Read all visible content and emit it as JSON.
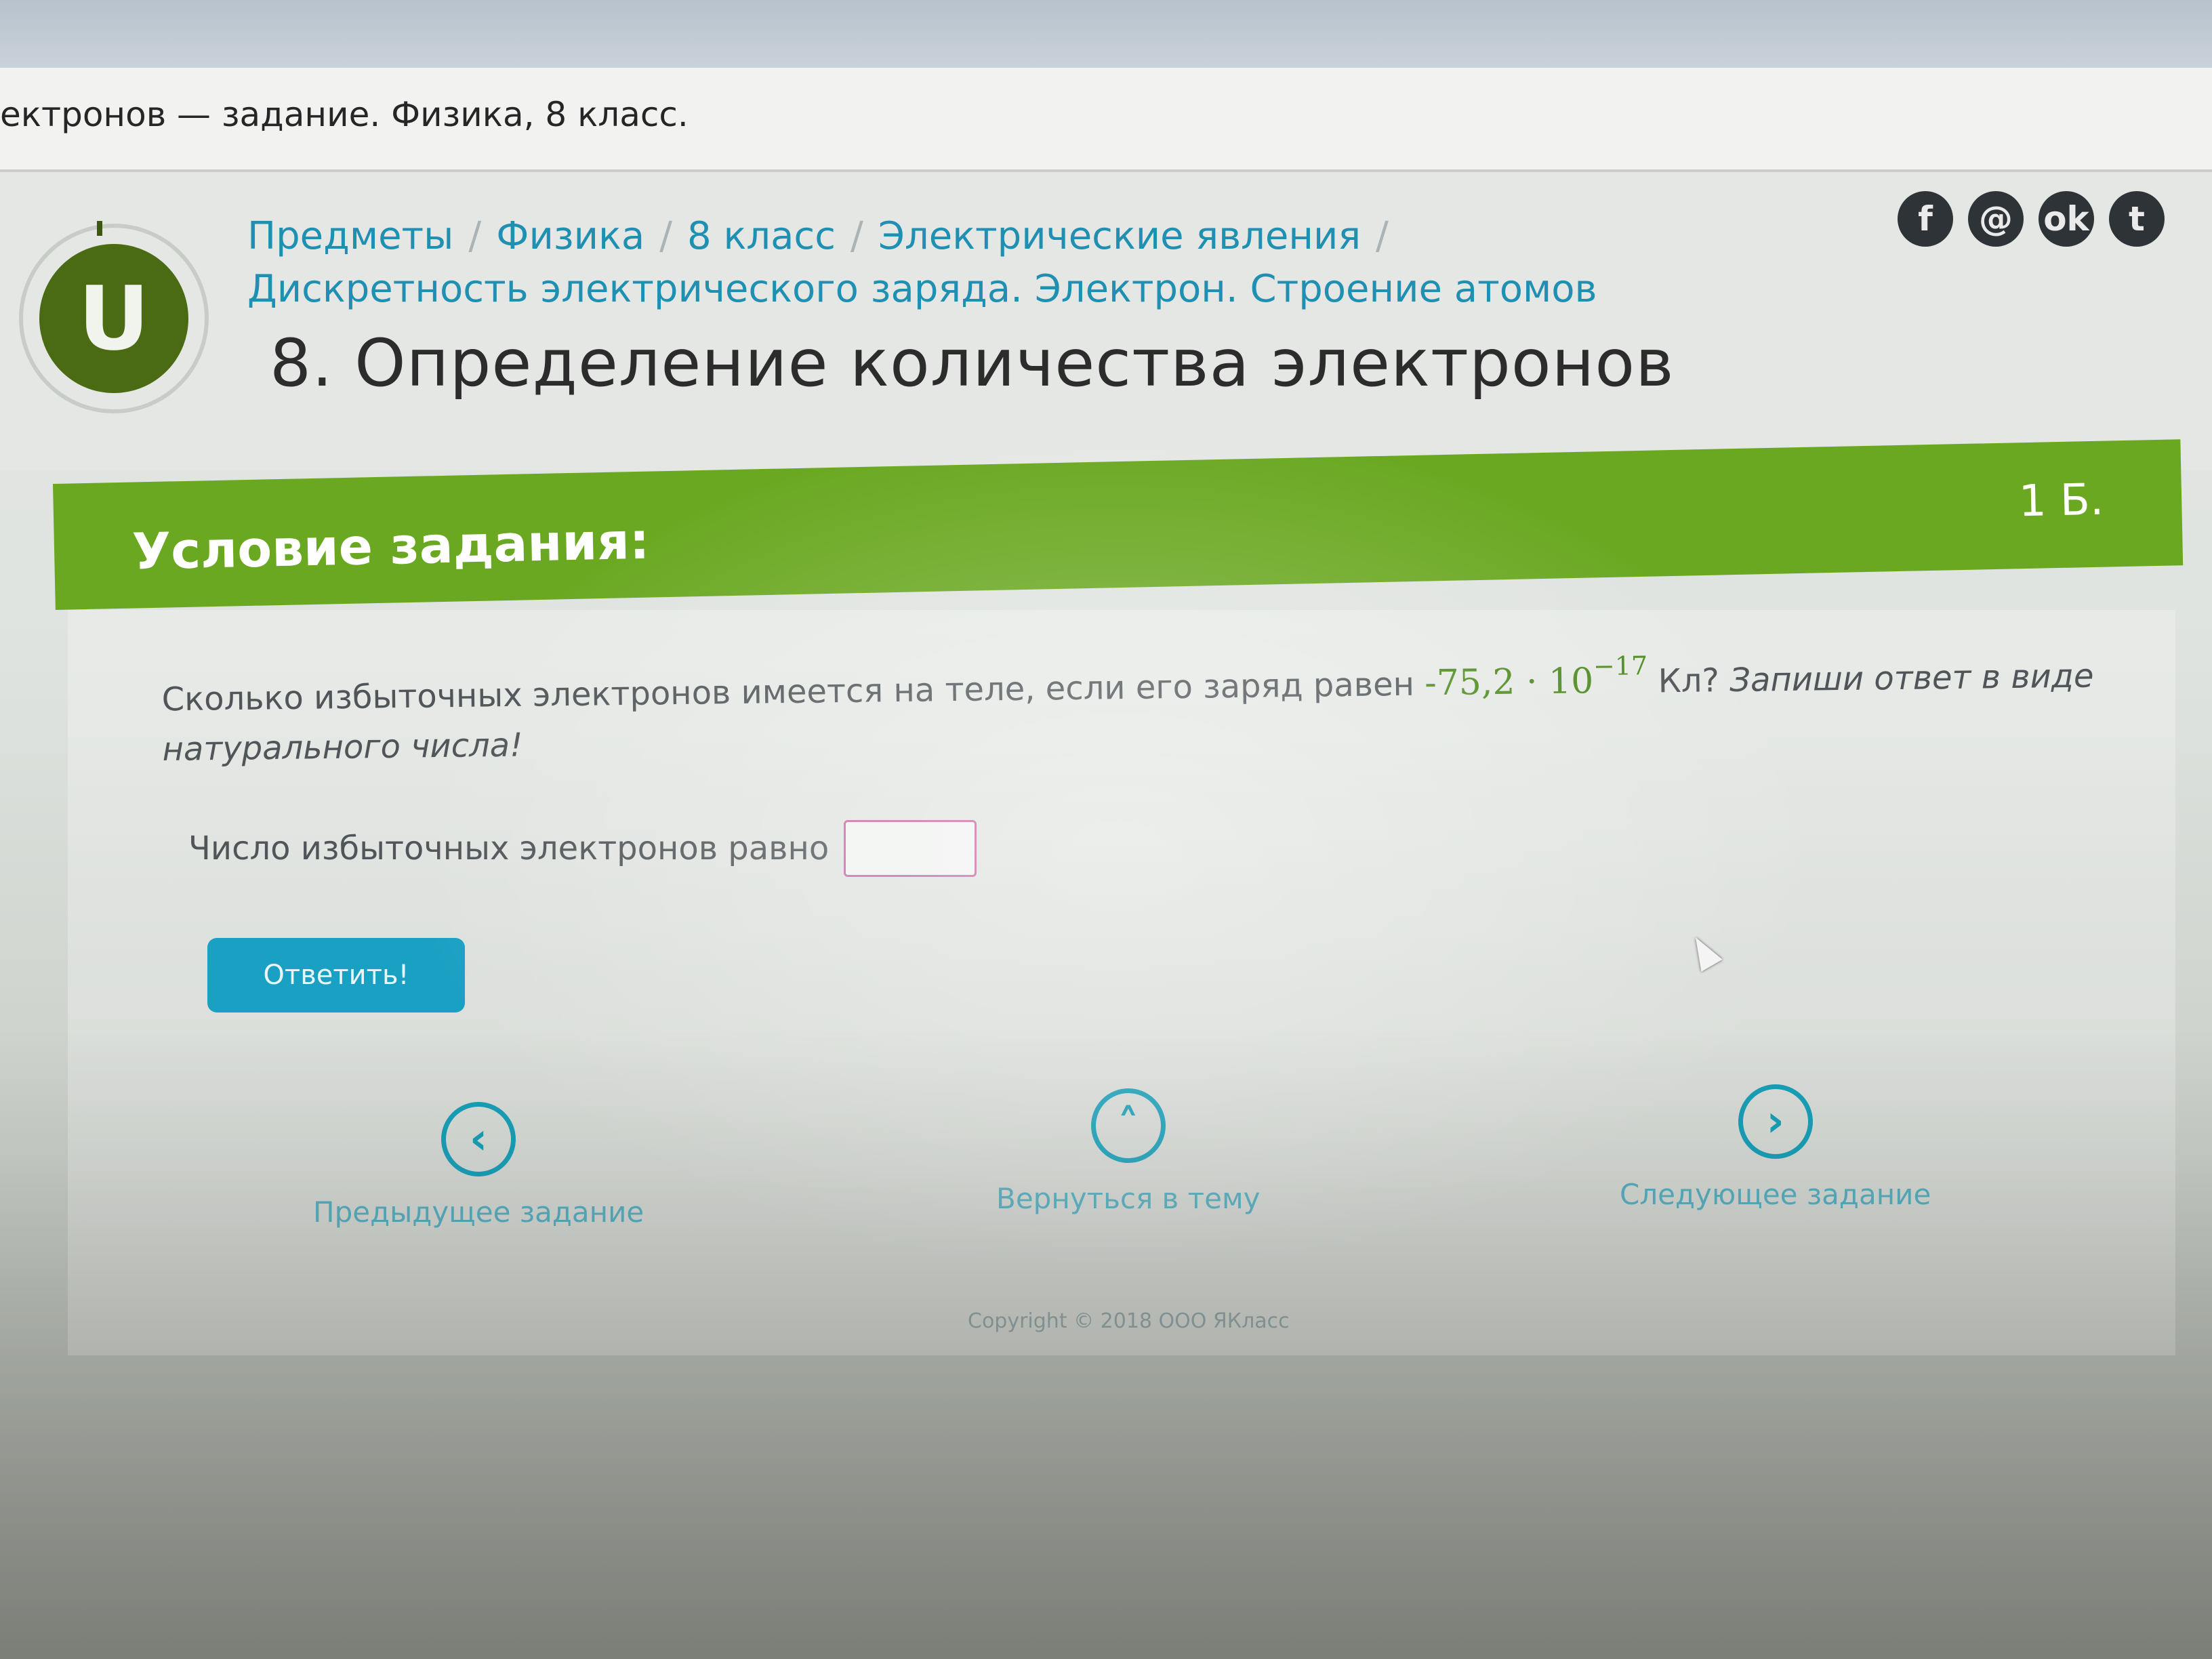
{
  "window": {
    "title": "ектронов — задание. Физика, 8 класс."
  },
  "header": {
    "logo_letter": "U",
    "breadcrumb": [
      "Предметы",
      "Физика",
      "8 класс",
      "Электрические явления",
      "Дискретность электрического заряда. Электрон. Строение атомов"
    ],
    "separator": "/",
    "page_title": "8. Определение количества электронов",
    "social": [
      {
        "icon": "facebook-icon",
        "glyph": "f"
      },
      {
        "icon": "mail-icon",
        "glyph": "@"
      },
      {
        "icon": "odnoklassniki-icon",
        "glyph": "ok"
      },
      {
        "icon": "twitter-icon",
        "glyph": "t"
      }
    ]
  },
  "task": {
    "heading": "Условие задания:",
    "points": "1 Б.",
    "question_prefix": "Сколько избыточных электронов имеется на теле, если его заряд равен ",
    "charge_mantissa": "-75,2 · 10",
    "charge_exponent": "−17",
    "question_suffix_unit": " Кл?",
    "question_suffix_italic": " Запиши ответ в виде натурального числа!",
    "answer_label": "Число избыточных электронов равно",
    "answer_value": "",
    "submit_label": "Ответить!"
  },
  "navigation": {
    "prev_label": "Предыдущее задание",
    "back_label": "Вернуться в тему",
    "next_label": "Следующее задание"
  },
  "footer": {
    "copyright": "Copyright © 2018 ООО ЯКласс"
  },
  "colors": {
    "accent_green": "#6aa821",
    "link_blue": "#1f8fb2",
    "button_blue": "#1aa0c3",
    "logo_green": "#4a6b14"
  }
}
